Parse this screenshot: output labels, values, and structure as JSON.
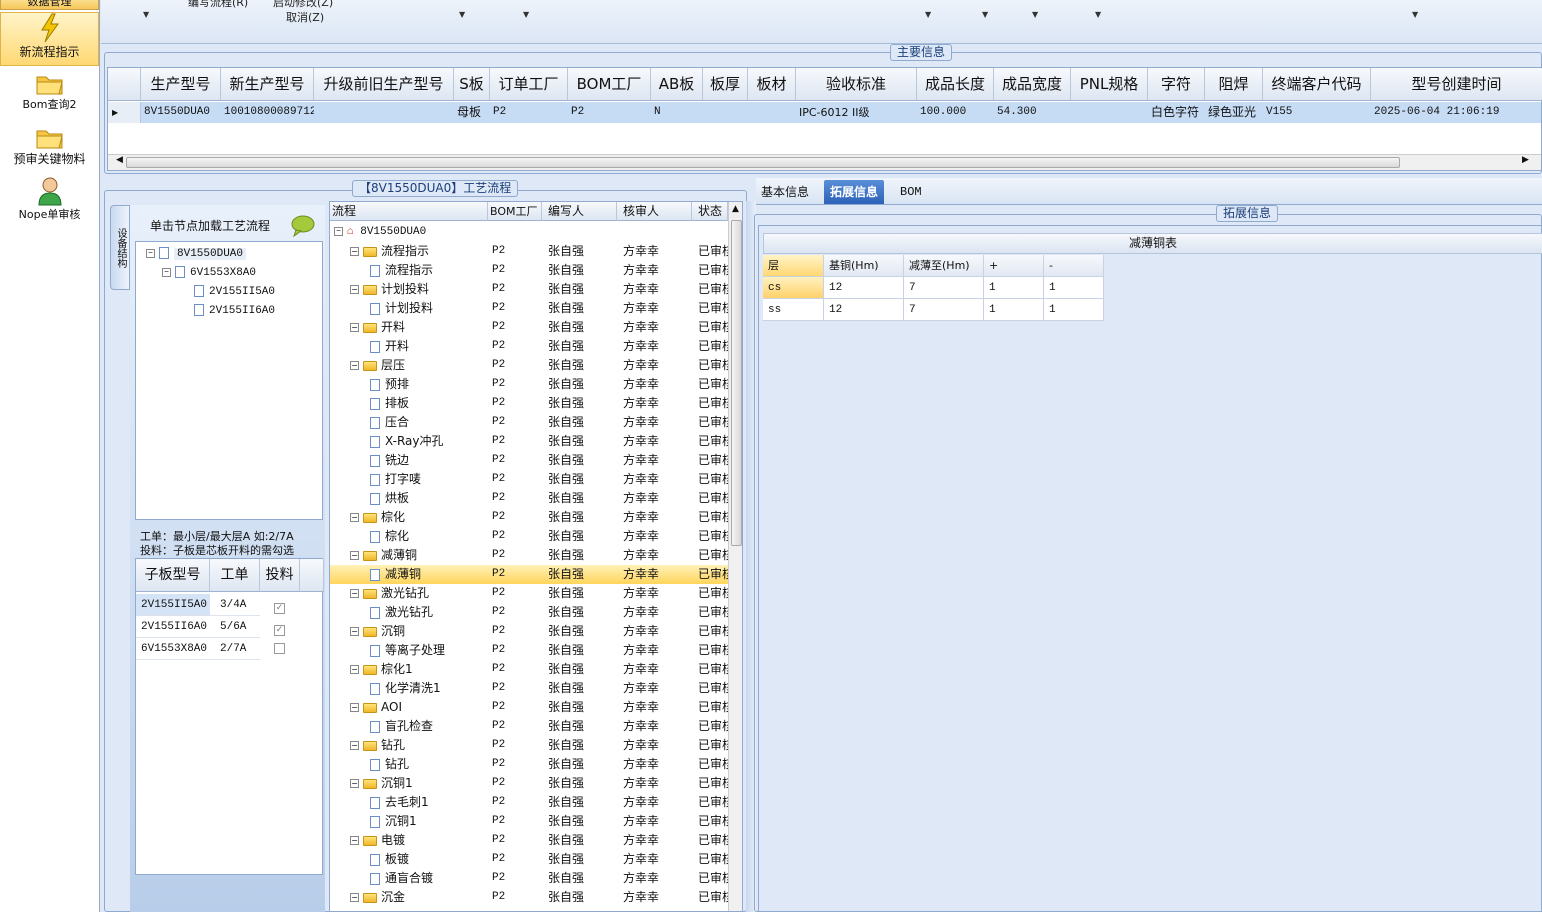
{
  "sidebar": {
    "top_label": "数据管理",
    "items": [
      {
        "label": "新流程指示",
        "icon": "lightning-icon"
      },
      {
        "label": "Bom查询2",
        "icon": "folder-icon"
      },
      {
        "label": "预审关键物料",
        "icon": "folder-icon"
      },
      {
        "label": "Nope单审核",
        "icon": "user-icon"
      }
    ]
  },
  "topbar": {
    "text1": "编写流程(R)",
    "text2": "启动修改(Z)",
    "text3": "取消(Z)"
  },
  "main_info": {
    "title": "主要信息",
    "columns": [
      "生产型号",
      "新生产型号",
      "升级前旧生产型号",
      "S板",
      "订单工厂",
      "BOM工厂",
      "AB板",
      "板厚",
      "板材",
      "验收标准",
      "成品长度",
      "成品宽度",
      "PNL规格",
      "字符",
      "阻焊",
      "终端客户代码",
      "型号创建时间"
    ],
    "row": [
      "8V1550DUA0",
      "10010800089712",
      "",
      "母板",
      "P2",
      "P2",
      "N",
      "",
      "",
      "IPC-6012 II级",
      "100.000",
      "54.300",
      "",
      "白色字符",
      "绿色亚光",
      "V155",
      "2025-06-04 21:06:19"
    ]
  },
  "process": {
    "title": "【8V1550DUA0】工艺流程",
    "side_tab": "设备结构",
    "load_hint": "单击节点加载工艺流程",
    "tree": [
      "8V1550DUA0",
      "6V1553X8A0",
      "2V155II5A0",
      "2V155II6A0"
    ],
    "note1": "工单：最小层/最大层A 如:2/7A",
    "note2": "投料：子板是芯板开料的需勾选",
    "sub_headers": [
      "子板型号",
      "工单",
      "投料"
    ],
    "sub_rows": [
      {
        "model": "2V155II5A0",
        "order": "3/4A",
        "checked": "✓"
      },
      {
        "model": "2V155II6A0",
        "order": "5/6A",
        "checked": "✓"
      },
      {
        "model": "6V1553X8A0",
        "order": "2/7A",
        "checked": ""
      }
    ]
  },
  "flow": {
    "headers": [
      "流程",
      "BOM工厂",
      "编写人",
      "核审人",
      "状态"
    ],
    "root": "8V1550DUA0",
    "factory": "P2",
    "writer": "张自强",
    "reviewer": "方幸幸",
    "status": "已审核",
    "rows": [
      {
        "name": "流程指示",
        "folder": true
      },
      {
        "name": "流程指示",
        "folder": false
      },
      {
        "name": "计划投料",
        "folder": true
      },
      {
        "name": "计划投料",
        "folder": false
      },
      {
        "name": "开料",
        "folder": true
      },
      {
        "name": "开料",
        "folder": false
      },
      {
        "name": "层压",
        "folder": true
      },
      {
        "name": "预排",
        "folder": false
      },
      {
        "name": "排板",
        "folder": false
      },
      {
        "name": "压合",
        "folder": false
      },
      {
        "name": "X-Ray冲孔",
        "folder": false
      },
      {
        "name": "铣边",
        "folder": false
      },
      {
        "name": "打字唛",
        "folder": false
      },
      {
        "name": "烘板",
        "folder": false
      },
      {
        "name": "棕化",
        "folder": true
      },
      {
        "name": "棕化",
        "folder": false
      },
      {
        "name": "减薄铜",
        "folder": true
      },
      {
        "name": "减薄铜",
        "folder": false,
        "selected": true
      },
      {
        "name": "激光钻孔",
        "folder": true
      },
      {
        "name": "激光钻孔",
        "folder": false
      },
      {
        "name": "沉铜",
        "folder": true
      },
      {
        "name": "等离子处理",
        "folder": false
      },
      {
        "name": "棕化1",
        "folder": true
      },
      {
        "name": "化学清洗1",
        "folder": false
      },
      {
        "name": "AOI",
        "folder": true
      },
      {
        "name": "盲孔检查",
        "folder": false
      },
      {
        "name": "钻孔",
        "folder": true
      },
      {
        "name": "钻孔",
        "folder": false
      },
      {
        "name": "沉铜1",
        "folder": true
      },
      {
        "name": "去毛刺1",
        "folder": false
      },
      {
        "name": "沉铜1",
        "folder": false
      },
      {
        "name": "电镀",
        "folder": true
      },
      {
        "name": "板镀",
        "folder": false
      },
      {
        "name": "通盲合镀",
        "folder": false
      },
      {
        "name": "沉金",
        "folder": true
      }
    ]
  },
  "right": {
    "tabs": [
      "基本信息",
      "拓展信息",
      "BOM"
    ],
    "section_title": "拓展信息",
    "table_title": "减薄铜表",
    "headers": [
      "层",
      "基铜(Hm)",
      "减薄至(Hm)",
      "+",
      "-"
    ],
    "rows": [
      [
        "cs",
        "12",
        "7",
        "1",
        "1"
      ],
      [
        "ss",
        "12",
        "7",
        "1",
        "1"
      ]
    ]
  }
}
